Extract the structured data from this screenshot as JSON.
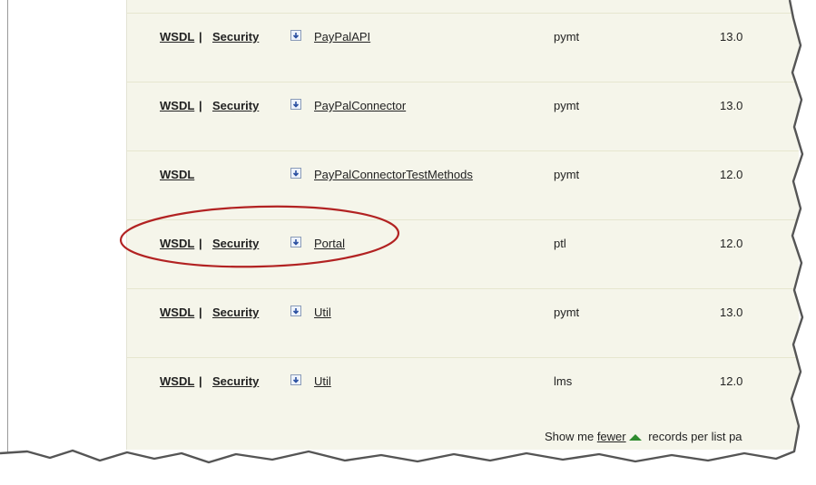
{
  "rows": [
    {
      "wsdl": "WSDL",
      "sep": " | ",
      "security": "Security",
      "name": "PayPalAPI",
      "namespace": "pymt",
      "version": "13.0"
    },
    {
      "wsdl": "WSDL",
      "sep": " | ",
      "security": "Security",
      "name": "PayPalConnector",
      "namespace": "pymt",
      "version": "13.0"
    },
    {
      "wsdl": "WSDL",
      "sep": "",
      "security": "",
      "name": "PayPalConnectorTestMethods",
      "namespace": "pymt",
      "version": "12.0"
    },
    {
      "wsdl": "WSDL",
      "sep": " | ",
      "security": "Security",
      "name": "Portal",
      "namespace": "ptl",
      "version": "12.0"
    },
    {
      "wsdl": "WSDL",
      "sep": " | ",
      "security": "Security",
      "name": "Util",
      "namespace": "pymt",
      "version": "13.0"
    },
    {
      "wsdl": "WSDL",
      "sep": " | ",
      "security": "Security",
      "name": "Util",
      "namespace": "lms",
      "version": "12.0"
    }
  ],
  "footer": {
    "prefix": "Show me ",
    "fewer": "fewer",
    "suffix": " records per list pa"
  },
  "colors": {
    "highlight": "#b22222",
    "fewer_arrow": "#2e8b2e",
    "panel_bg": "#f5f5ea"
  },
  "icons": {
    "download": "download-icon",
    "fewer": "arrow-up-icon"
  }
}
